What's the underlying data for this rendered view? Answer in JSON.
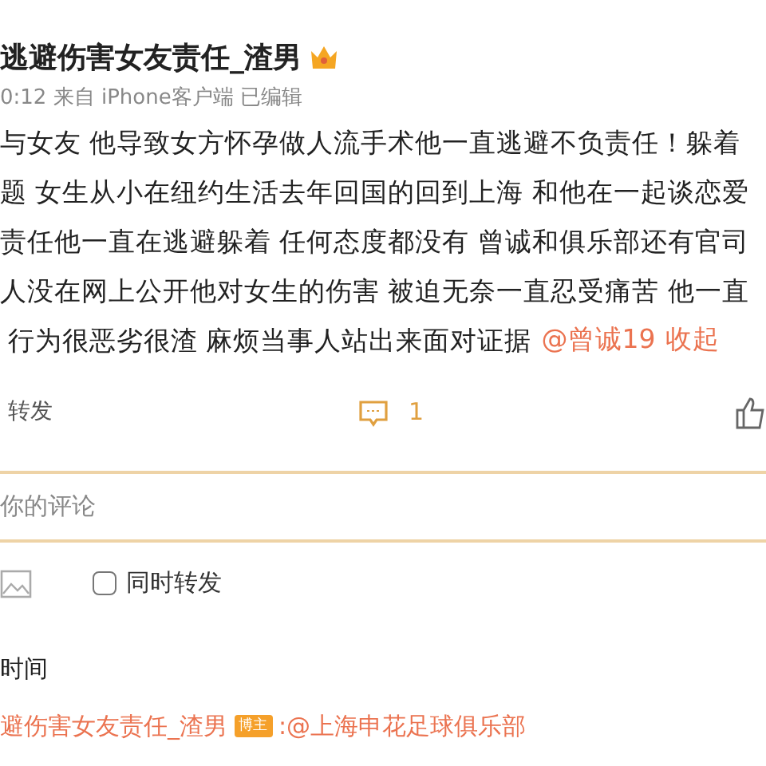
{
  "post": {
    "author": "逃避伤害女友责任_渣男",
    "meta": "0:12 来自 iPhone客户端 已编辑",
    "lines": [
      "与女友 他导致女方怀孕做人流手术他一直逃避不负责任！躲着",
      "题 女生从小在纽约生活去年回国的回到上海 和他在一起谈恋爱",
      "责任他一直在逃避躲着 任何态度都没有 曾诚和俱乐部还有官司",
      "人没在网上公开他对女生的伤害 被迫无奈一直忍受痛苦 他一直",
      "行为很恶劣很渣 麻烦当事人站出来面对证据"
    ],
    "mention": "@曾诚19",
    "collapse": "收起"
  },
  "actions": {
    "repost": "转发",
    "comments": "1"
  },
  "comment_box": {
    "placeholder": "你的评论",
    "also_repost": {
      "label": "同时转发",
      "checked": false
    }
  },
  "sort_label": "时间",
  "comment": {
    "author": "避伤害女友责任_渣男",
    "badge": "博主",
    "text": ":@上海申花足球俱乐部"
  }
}
